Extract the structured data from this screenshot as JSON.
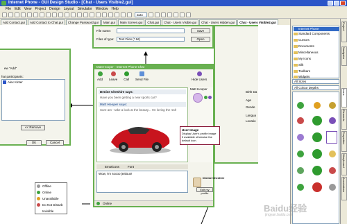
{
  "app": {
    "title": "Internet Phone - GUI Design Studio - [Chat - Users Visible2.gui]"
  },
  "menu": [
    "File",
    "Edit",
    "View",
    "Project",
    "Design",
    "Layout",
    "Simulator",
    "Window",
    "Help"
  ],
  "toolbar": {
    "zoom_value": "auto"
  },
  "tabs": [
    "Add Contact.gui",
    "Add Contact to Chat.gui",
    "Change Password.gui",
    "Main.gui",
    "Main Screen.gui",
    "Chat.gui",
    "Chat - Users Visible.gui",
    "Chat - Users Hidden.gui",
    "Chat - Users Visible2.gui"
  ],
  "file_dialog": {
    "file_name_label": "File name:",
    "file_type_label": "Files of type:",
    "file_type_value": "Text Files (*.txt)",
    "save_label": "Save",
    "open_label": "Open"
  },
  "left_dialog": {
    "title_frag": "ew \"Add\"",
    "participants_label": "hat participants:",
    "participant": "Alex Kinter",
    "remove_label": "<< Remove",
    "ok_label": "OK",
    "cancel_label": "Cancel"
  },
  "chat": {
    "title": "Matt Hooper - Internet Phone Chat",
    "actions": {
      "add": "Add",
      "leave": "Leave",
      "call": "Call",
      "sendfile": "Send File"
    },
    "hide_users": "Hide Users",
    "user_name": "Matt Hooper",
    "msg1_name": "Denise Cheshire says:",
    "msg1_text": "Have you been getting a new sports car?",
    "msg2_name": "Matt Hooper says:",
    "msg2_text": "Sure am - take a look at the beauty... I'm loving the red!",
    "emoticons": "Emoticons",
    "font": "Font",
    "input_text": "Wow, I'm soooo jealous!",
    "self_name": "Denise Cheshire",
    "edit_profile": "Edit my profile",
    "status": "Online"
  },
  "tooltip": {
    "title": "User Image",
    "text": "Display User's profile image if available otherwise the default icon."
  },
  "status_menu": [
    "Offline",
    "Online",
    "Unavailable",
    "Do Not Disturb",
    "Invisible"
  ],
  "props_dialog": {
    "fields": [
      "Birth Da",
      "Age",
      "Gende",
      "Langua",
      "Locatio"
    ]
  },
  "project_panel": {
    "title": "Internet Phone",
    "items": [
      "Standard Components",
      "Cursors",
      "Documents",
      "Miscellaneous",
      "My Icons",
      "Silk",
      "Toolbars",
      "Widgets"
    ],
    "all_sizes": "All Sizes",
    "all_depths": "All Colour Depths"
  },
  "side_tabs": [
    "Icons",
    "Elements",
    "Properties",
    "Storyboard",
    "Annotations",
    "Navigator",
    "Project"
  ],
  "watermark": "Baidu经验",
  "watermark_url": "jingyan.baidu.com",
  "colors": {
    "green": "#68b050",
    "title_blue": "#2b55c8",
    "chrome": "#ece9d8",
    "tooltip_border": "#8a1b3a"
  }
}
